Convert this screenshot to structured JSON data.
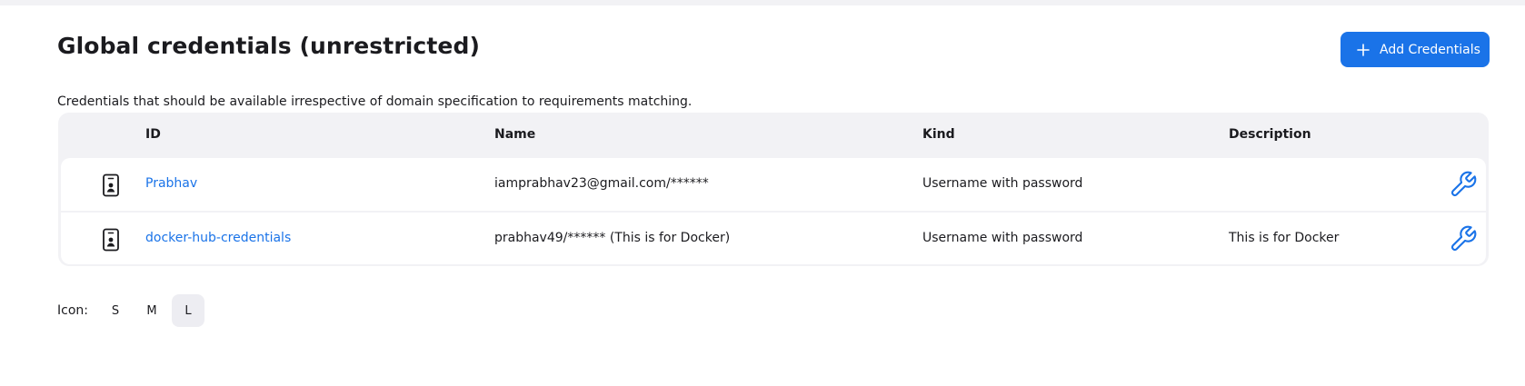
{
  "header": {
    "title": "Global credentials (unrestricted)",
    "add_button_label": "Add Credentials",
    "add_button_icon": "plus-icon",
    "description": "Credentials that should be available irrespective of domain specification to requirements matching."
  },
  "table": {
    "columns": [
      "ID",
      "Name",
      "Kind",
      "Description"
    ],
    "rows": [
      {
        "icon": "credential-card-icon",
        "id": "Prabhav",
        "name": "iamprabhav23@gmail.com/******",
        "kind": "Username with password",
        "description": "",
        "action_icon": "wrench-icon"
      },
      {
        "icon": "credential-card-icon",
        "id": "docker-hub-credentials",
        "name": "prabhav49/****** (This is for Docker)",
        "kind": "Username with password",
        "description": "This is for Docker",
        "action_icon": "wrench-icon"
      }
    ]
  },
  "icon_size": {
    "label": "Icon:",
    "options": [
      "S",
      "M",
      "L"
    ],
    "selected": "L"
  },
  "colors": {
    "accent": "#1a73e8",
    "table_bg": "#f2f2f5",
    "selected_size_bg": "#ededf2"
  }
}
